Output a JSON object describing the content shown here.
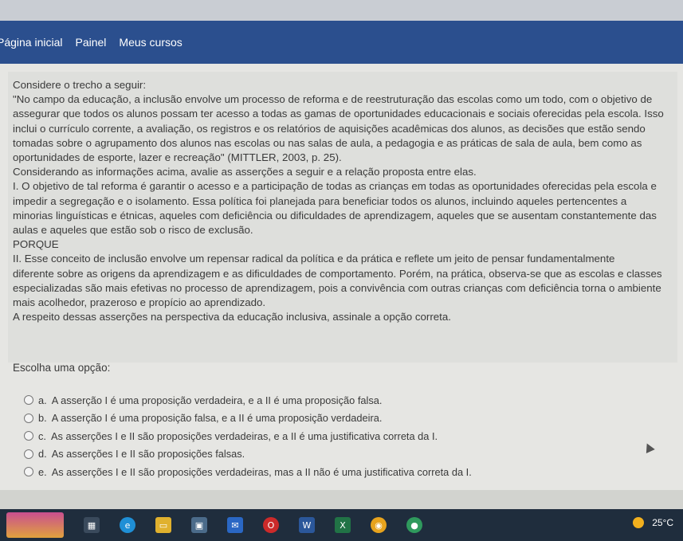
{
  "nav": {
    "items": [
      "Página inicial",
      "Painel",
      "Meus cursos"
    ]
  },
  "question": {
    "paragraphs": [
      "Considere o trecho a seguir:",
      "\"No campo da educação, a inclusão envolve um processo de reforma e de reestruturação das escolas como um todo, com o objetivo de",
      "assegurar que todos os alunos possam ter acesso a todas as gamas de oportunidades educacionais e sociais oferecidas pela escola. Isso",
      "inclui o currículo corrente, a avaliação, os registros e os relatórios de aquisições acadêmicas dos alunos, as decisões que estão sendo",
      "tomadas sobre o agrupamento dos alunos nas escolas ou nas salas de aula, a pedagogia e as práticas de sala de aula, bem como as",
      "oportunidades de esporte, lazer e recreação\" (MITTLER, 2003, p. 25).",
      "Considerando as informações acima, avalie as asserções a seguir e a relação proposta entre elas.",
      "I. O objetivo de tal reforma é garantir o acesso e a participação de todas as crianças em todas as oportunidades oferecidas pela escola e",
      "impedir a segregação e o isolamento. Essa política foi planejada para beneficiar todos os alunos, incluindo aqueles pertencentes a",
      "minorias linguísticas e étnicas, aqueles com deficiência ou dificuldades de aprendizagem, aqueles que se ausentam constantemente das",
      "aulas e aqueles que estão sob o risco de exclusão.",
      "PORQUE",
      "II. Esse conceito de inclusão envolve um repensar radical da política e da prática e reflete um jeito de pensar fundamentalmente",
      "diferente sobre as origens da aprendizagem e as dificuldades de comportamento. Porém, na prática, observa-se que as escolas e classes",
      "especializadas são mais efetivas no processo de aprendizagem, pois a convivência com outras crianças com deficiência torna o ambiente",
      "mais acolhedor, prazeroso e propício ao aprendizado.",
      "A respeito dessas asserções na perspectiva da educação inclusiva, assinale a opção correta."
    ]
  },
  "prompt_label": "Escolha uma opção:",
  "options": [
    {
      "letter": "a.",
      "text": "A asserção I é uma proposição verdadeira, e a II é uma proposição falsa."
    },
    {
      "letter": "b.",
      "text": "A asserção I é uma proposição falsa, e a II é uma proposição verdadeira."
    },
    {
      "letter": "c.",
      "text": "As asserções I e II são proposições verdadeiras, e a II é uma justificativa correta da I."
    },
    {
      "letter": "d.",
      "text": "As asserções I e II são proposições falsas."
    },
    {
      "letter": "e.",
      "text": "As asserções I e II são proposições verdadeiras, mas a II não é uma justificativa correta da I."
    }
  ],
  "taskbar": {
    "weather": "25°C"
  }
}
